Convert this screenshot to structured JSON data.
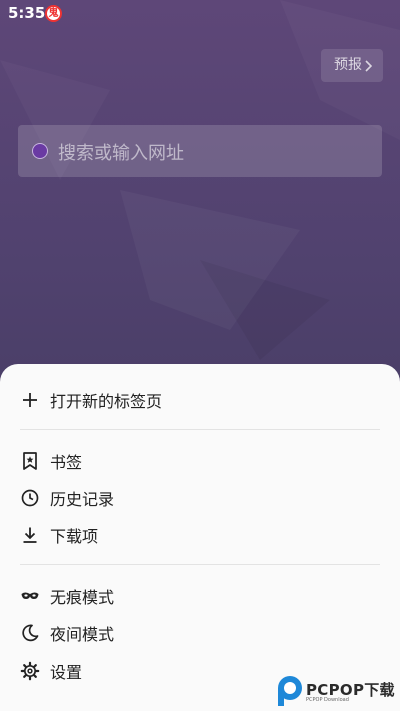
{
  "status": {
    "time": "5:35",
    "notification_badge": "鬼"
  },
  "header": {
    "forecast_label": "预报"
  },
  "search": {
    "placeholder": "搜索或输入网址"
  },
  "menu": {
    "new_tab": "打开新的标签页",
    "bookmarks": "书签",
    "history": "历史记录",
    "downloads": "下载项",
    "incognito": "无痕模式",
    "night_mode": "夜间模式",
    "settings": "设置"
  },
  "watermark": {
    "brand": "PCPOP下载",
    "sub": "PCPOP Download"
  },
  "colors": {
    "background_top": "#5e4778",
    "background_bottom": "#3b3a5a",
    "sheet": "#fafafa",
    "search_icon": "#6a3aa3"
  }
}
